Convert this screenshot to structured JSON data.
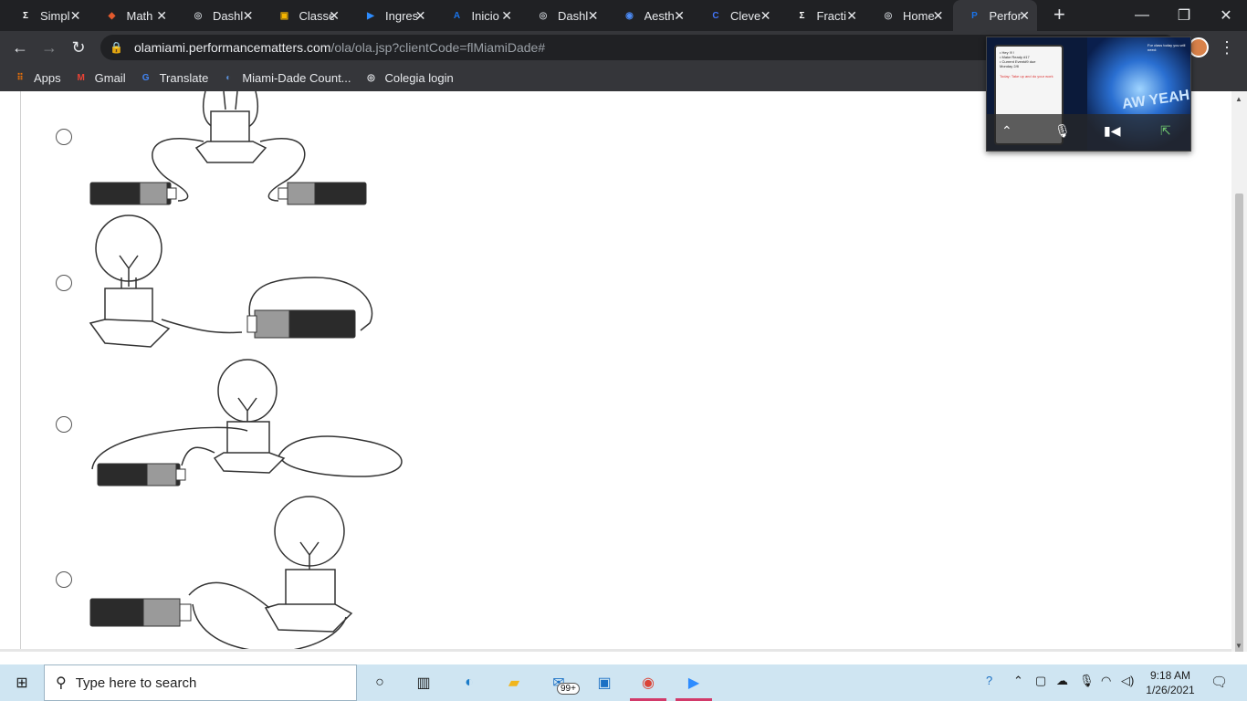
{
  "tabs": [
    {
      "title": "Simpl",
      "icon": "sigma",
      "color": "#ffffff",
      "glyph": "Σ"
    },
    {
      "title": "Math",
      "icon": "cube",
      "color": "#e25a2d",
      "glyph": "◆"
    },
    {
      "title": "Dashl",
      "icon": "globe",
      "color": "#bdc1c6",
      "glyph": "◎"
    },
    {
      "title": "Classe",
      "icon": "classroom",
      "color": "#f4b400",
      "glyph": "▣"
    },
    {
      "title": "Ingres",
      "icon": "zoom",
      "color": "#2d8cff",
      "glyph": "▶"
    },
    {
      "title": "Inicio",
      "icon": "a-logo",
      "color": "#1a73e8",
      "glyph": "A"
    },
    {
      "title": "Dashl",
      "icon": "globe",
      "color": "#bdc1c6",
      "glyph": "◎"
    },
    {
      "title": "Aesth",
      "icon": "user-circle",
      "color": "#4c8bf5",
      "glyph": "◉"
    },
    {
      "title": "Cleve",
      "icon": "clever",
      "color": "#4274f6",
      "glyph": "C"
    },
    {
      "title": "Fracti",
      "icon": "sigma",
      "color": "#ffffff",
      "glyph": "Σ"
    },
    {
      "title": "Home",
      "icon": "globe",
      "color": "#bdc1c6",
      "glyph": "◎"
    },
    {
      "title": "Perfor",
      "icon": "p-logo",
      "color": "#1a73e8",
      "glyph": "P"
    }
  ],
  "active_tab_index": 11,
  "toolbar": {
    "back": "←",
    "forward": "→",
    "reload": "↻",
    "url_domain": "olamiami.performancematters.com",
    "url_path": "/ola/ola.jsp?clientCode=flMiamiDade#",
    "menu": "⋮"
  },
  "bookmarks": [
    {
      "label": "Apps",
      "icon": "apps-grid-icon",
      "color": "#e8710a",
      "glyph": "⠿"
    },
    {
      "label": "Gmail",
      "icon": "gmail-icon",
      "color": "#ea4335",
      "glyph": "M"
    },
    {
      "label": "Translate",
      "icon": "translate-icon",
      "color": "#4285f4",
      "glyph": "G"
    },
    {
      "label": "Miami-Dade Count...",
      "icon": "miami-dade-icon",
      "color": "#5b8fd6",
      "glyph": "◐"
    },
    {
      "label": "Colegia login",
      "icon": "globe-icon",
      "color": "#e8eaed",
      "glyph": "◎"
    }
  ],
  "zoom_overlay": {
    "slide_lines": [
      "• Hey !!! !",
      "• Make Ready #17",
      "• Current Event#9 due",
      "  Monday 2/8"
    ],
    "slide_red": "Today: Take up and do your work",
    "glow_text": "AW YEAH",
    "corner_text": "For class today you will need:"
  },
  "taskbar": {
    "search_placeholder": "Type here to search",
    "mail_badge": "99+",
    "time": "9:18 AM",
    "date": "1/26/2021"
  }
}
